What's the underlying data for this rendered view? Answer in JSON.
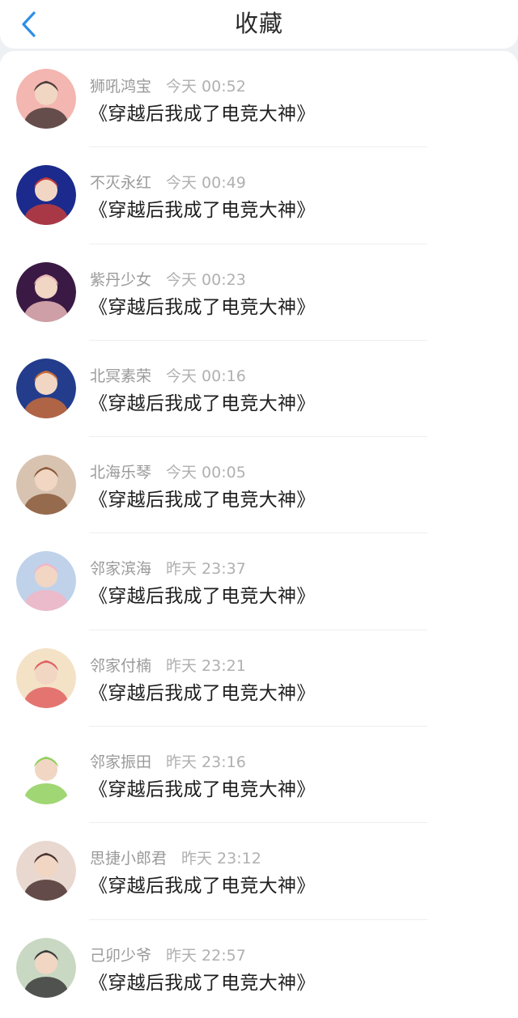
{
  "header": {
    "title": "收藏",
    "back_icon": "chevron-left-icon",
    "accent_color": "#2e8ee8"
  },
  "favorites": [
    {
      "user": "狮吼鸿宝",
      "time": "今天 00:52",
      "book": "《穿越后我成了电竞大神》",
      "avatar_colors": [
        "#f3b6b0",
        "#4a3b38"
      ]
    },
    {
      "user": "不灭永红",
      "time": "今天 00:49",
      "book": "《穿越后我成了电竞大神》",
      "avatar_colors": [
        "#1b2a8c",
        "#c23b3b"
      ]
    },
    {
      "user": "紫丹少女",
      "time": "今天 00:23",
      "book": "《穿越后我成了电竞大神》",
      "avatar_colors": [
        "#3a1a44",
        "#e9b7b7"
      ]
    },
    {
      "user": "北冥素荣",
      "time": "今天 00:16",
      "book": "《穿越后我成了电竞大神》",
      "avatar_colors": [
        "#233d8c",
        "#c96b3a"
      ]
    },
    {
      "user": "北海乐琴",
      "time": "今天 00:05",
      "book": "《穿越后我成了电竞大神》",
      "avatar_colors": [
        "#d8c3b1",
        "#8b5a3c"
      ]
    },
    {
      "user": "邻家滨海",
      "time": "昨天 23:37",
      "book": "《穿越后我成了电竞大神》",
      "avatar_colors": [
        "#bfd2ea",
        "#f2b6c6"
      ]
    },
    {
      "user": "邻家付楠",
      "time": "昨天 23:21",
      "book": "《穿越后我成了电竞大神》",
      "avatar_colors": [
        "#f4e2c7",
        "#e06060"
      ]
    },
    {
      "user": "邻家振田",
      "time": "昨天 23:16",
      "book": "《穿越后我成了电竞大神》",
      "avatar_colors": [
        "#ffffff",
        "#8fcf5a"
      ]
    },
    {
      "user": "思捷小郎君",
      "time": "昨天 23:12",
      "book": "《穿越后我成了电竞大神》",
      "avatar_colors": [
        "#e9d8cf",
        "#4a3330"
      ]
    },
    {
      "user": "己卯少爷",
      "time": "昨天 22:57",
      "book": "《穿越后我成了电竞大神》",
      "avatar_colors": [
        "#c9d8c2",
        "#3b3b3b"
      ]
    }
  ]
}
